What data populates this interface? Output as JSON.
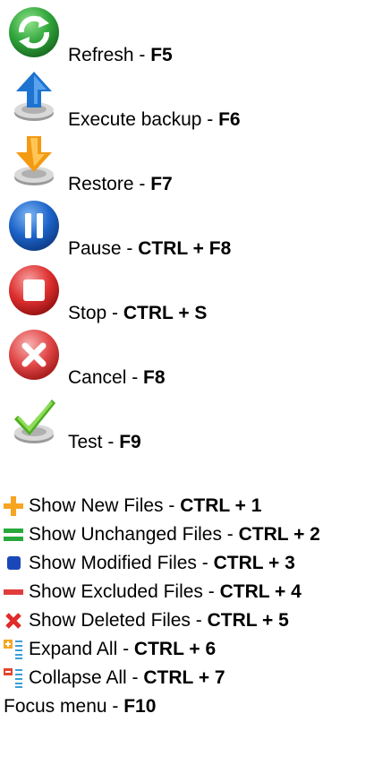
{
  "primary_actions": [
    {
      "icon": "refresh-icon",
      "label": "Refresh - ",
      "shortcut": "F5"
    },
    {
      "icon": "execute-backup-icon",
      "label": "Execute backup - ",
      "shortcut": "F6"
    },
    {
      "icon": "restore-icon",
      "label": "Restore - ",
      "shortcut": "F7"
    },
    {
      "icon": "pause-icon",
      "label": "Pause - ",
      "shortcut": "CTRL + F8"
    },
    {
      "icon": "stop-icon",
      "label": "Stop - ",
      "shortcut": "CTRL + S"
    },
    {
      "icon": "cancel-icon",
      "label": "Cancel - ",
      "shortcut": "F8"
    },
    {
      "icon": "test-icon",
      "label": "Test - ",
      "shortcut": "F9"
    }
  ],
  "view_actions": [
    {
      "icon": "plus-icon",
      "label": "Show New Files - ",
      "shortcut": "CTRL + 1"
    },
    {
      "icon": "equals-icon",
      "label": "Show Unchanged Files - ",
      "shortcut": "CTRL + 2"
    },
    {
      "icon": "square-icon",
      "label": "Show Modified Files - ",
      "shortcut": "CTRL + 3"
    },
    {
      "icon": "minus-icon",
      "label": "Show Excluded Files - ",
      "shortcut": "CTRL + 4"
    },
    {
      "icon": "cross-icon",
      "label": "Show Deleted Files - ",
      "shortcut": "CTRL + 5"
    },
    {
      "icon": "expand-all-icon",
      "label": "Expand All - ",
      "shortcut": "CTRL + 6"
    },
    {
      "icon": "collapse-all-icon",
      "label": "Collapse All - ",
      "shortcut": "CTRL + 7"
    }
  ],
  "focus_menu": {
    "label": "Focus menu - ",
    "shortcut": "F10"
  },
  "colors": {
    "refresh": "#2e9e3a",
    "backup": "#1e73d0",
    "restore": "#f39a12",
    "pause": "#1c63c9",
    "stop": "#de2f2f",
    "cancel": "#e14747",
    "test": "#4caf1e",
    "new": "#f7a521",
    "unchanged": "#27a83a",
    "modified": "#1b48b8",
    "excluded": "#e23b3b",
    "deleted": "#e02a2a"
  }
}
